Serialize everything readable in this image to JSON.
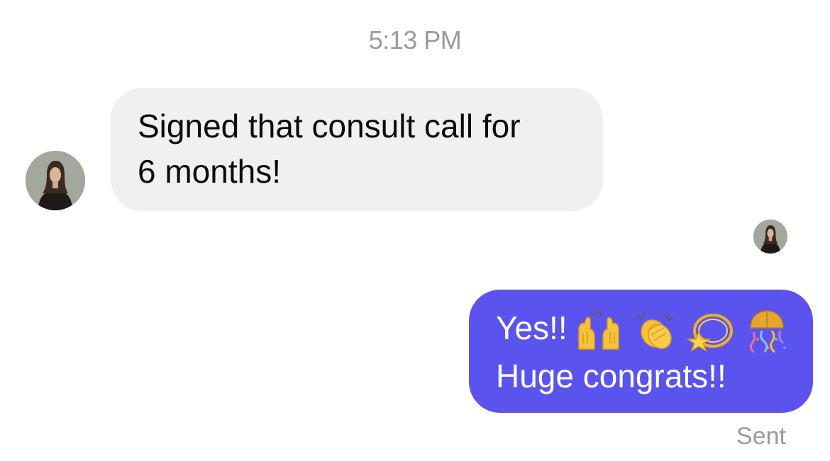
{
  "conversation": {
    "timestamp": "5:13 PM",
    "incoming": {
      "line1": "Signed that consult call for",
      "line2": "6 months!",
      "avatar": "contact-avatar"
    },
    "outgoing": {
      "line1": "Yes!!",
      "emojis": [
        "raising-hands-emoji",
        "clapping-hands-emoji",
        "dizzy-star-emoji",
        "confetti-ball-emoji"
      ],
      "line2": "Huge congrats!!",
      "status": "Sent",
      "read_avatar": "contact-read-avatar"
    }
  },
  "colors": {
    "incoming_bubble": "#f0f0f0",
    "outgoing_bubble": "#5b53ee",
    "meta_text": "#9a9a9f"
  }
}
